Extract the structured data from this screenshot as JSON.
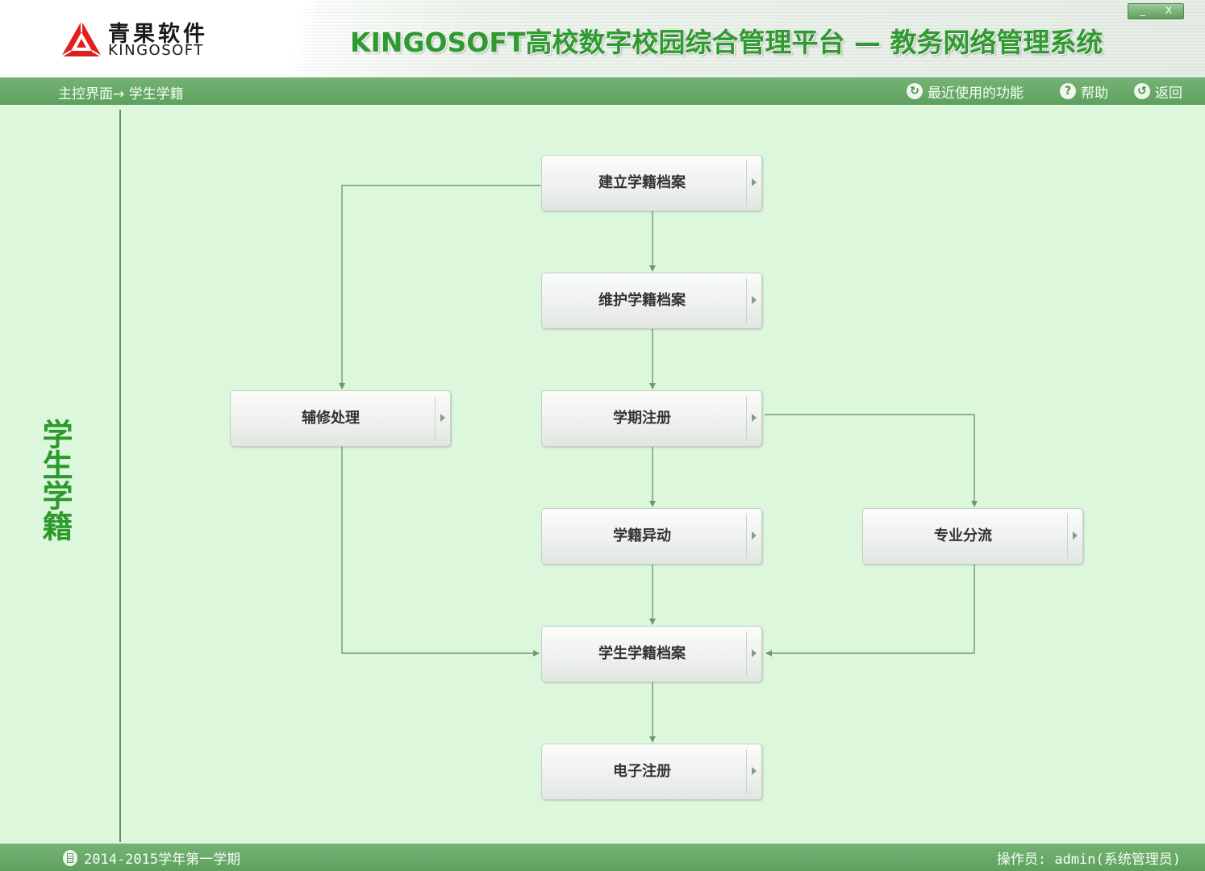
{
  "header": {
    "logo_cn": "青果软件",
    "logo_en": "KINGOSOFT",
    "app_title": "KINGOSOFT高校数字校园综合管理平台 — 教务网络管理系统",
    "minimize_glyph": "_",
    "close_glyph": "X"
  },
  "nav": {
    "breadcrumb": "主控界面→ 学生学籍",
    "recent_label": "最近使用的功能",
    "help_label": "帮助",
    "back_label": "返回",
    "recent_icon": "history-icon",
    "help_icon": "help-icon",
    "back_icon": "back-icon"
  },
  "sidebar": {
    "title": "学生学籍"
  },
  "flow": {
    "nodes": {
      "create": "建立学籍档案",
      "maintain": "维护学籍档案",
      "minor": "辅修处理",
      "register": "学期注册",
      "change": "学籍异动",
      "major_split": "专业分流",
      "archive": "学生学籍档案",
      "eregister": "电子注册"
    }
  },
  "status": {
    "term": "2014-2015学年第一学期",
    "operator": "操作员: admin(系统管理员)"
  },
  "colors": {
    "brand_green": "#2f9a2f",
    "bar_green": "#5da15d",
    "canvas_bg": "#ddf7dd",
    "logo_red": "#e02020",
    "connector": "#6d9a6d"
  }
}
